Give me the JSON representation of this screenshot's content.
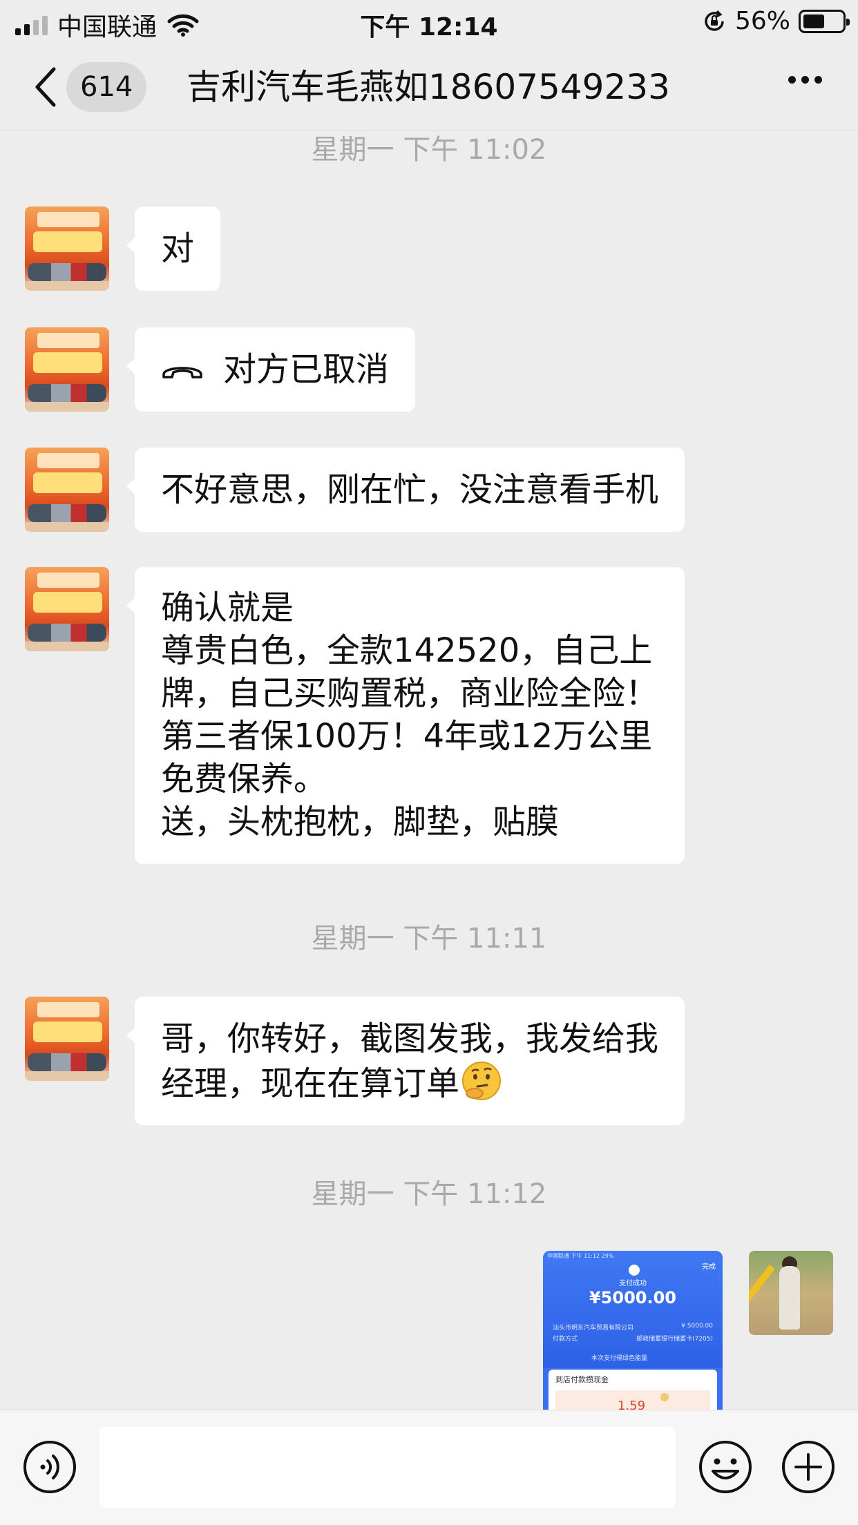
{
  "status_bar": {
    "carrier": "中国联通",
    "time": "下午 12:14",
    "battery": "56%"
  },
  "nav": {
    "unread_count": "614",
    "title": "吉利汽车毛燕如18607549233"
  },
  "messages": [
    {
      "time": "星期一 下午 11:02"
    },
    {
      "text": "对"
    },
    {
      "call_text": "对方已取消"
    },
    {
      "text": "不好意思，刚在忙，没注意看手机"
    },
    {
      "lines": [
        "确认就是",
        "尊贵白色，全款142520，自己上",
        "牌，自己买购置税，商业险全险！",
        "第三者保100万！4年或12万公里",
        "免费保养。",
        "送，头枕抱枕，脚垫，贴膜"
      ]
    },
    {
      "time": "星期一 下午 11:11"
    },
    {
      "lines": [
        "哥，你转好，截图发我，我发给我",
        "经理，现在在算订单"
      ]
    },
    {
      "time": "星期一 下午 11:12"
    }
  ],
  "sent_image": {
    "status": "中国联通   下午 11:12   29%",
    "done": "完成",
    "success": "支付成功",
    "amount": "¥5000.00",
    "merchant": "汕头市明东汽车贸易有限公司",
    "merchant_amount": "¥ 5000.00",
    "pay_method_label": "付款方式",
    "pay_method": "邮政储蓄银行储蓄卡(7205)",
    "green_note": "本次支付得绿色能量",
    "card_title": "到店付款攒现金",
    "card_number": "1.59"
  },
  "icons": {
    "back": "chevron-left-icon",
    "more": "more-dots-icon",
    "call": "phone-hangup-icon",
    "emoji_in_text": "thinking-face-icon",
    "voice": "voice-icon",
    "emoji_button": "smile-icon",
    "plus": "plus-icon"
  }
}
